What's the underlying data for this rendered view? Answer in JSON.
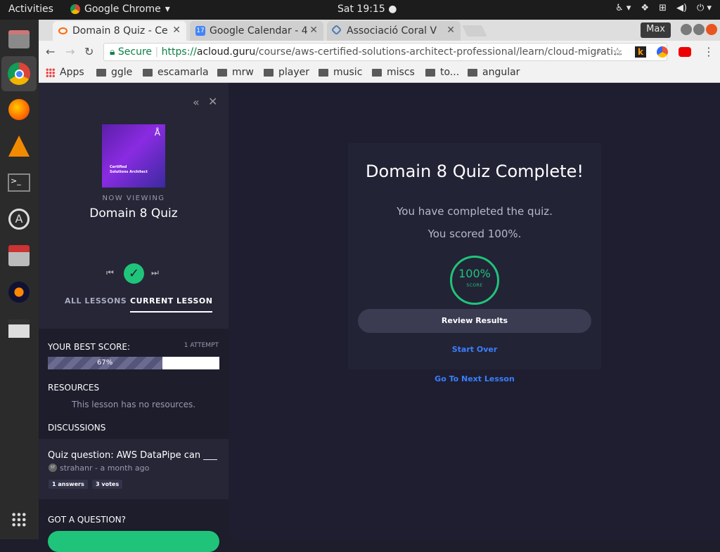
{
  "topbar": {
    "activities": "Activities",
    "app_name": "Google Chrome",
    "clock": "Sat 19:15"
  },
  "browser": {
    "tabs": [
      {
        "title": "Domain 8 Quiz - Ce",
        "active": true
      },
      {
        "title": "Google Calendar - 4",
        "active": false
      },
      {
        "title": "Associació Coral V",
        "active": false
      }
    ],
    "max_label": "Max",
    "secure_label": "Secure",
    "url_scheme": "https://",
    "url_host": "acloud.guru",
    "url_path": "/course/aws-certified-solutions-architect-professional/learn/cloud-migrati...",
    "bookmarks": [
      "Apps",
      "ggle",
      "escamarla",
      "mrw",
      "player",
      "music",
      "miscs",
      "to...",
      "angular"
    ]
  },
  "sidebar": {
    "now_viewing": "NOW VIEWING",
    "lesson_title": "Domain 8 Quiz",
    "thumb_text_1": "Certified",
    "thumb_text_2": "Solutions Architect",
    "tabs": [
      "ALL LESSONS",
      "CURRENT LESSON"
    ],
    "best_score_label": "YOUR BEST SCORE:",
    "attempts": "1 ATTEMPT",
    "best_score_value": "67%",
    "best_score_fraction": 0.67,
    "resources_label": "RESOURCES",
    "no_resources": "This lesson has no resources.",
    "discussions_label": "DISCUSSIONS",
    "discussion": {
      "title": "Quiz question: AWS DataPipe can ___",
      "avatar": "ST",
      "meta": "strahanr - a month ago",
      "answers": "1 answers",
      "votes": "3 votes"
    },
    "got_question": "GOT A QUESTION?"
  },
  "main": {
    "heading": "Domain 8 Quiz Complete!",
    "completed_text": "You have completed the quiz.",
    "scored_text": "You scored 100%.",
    "score_value": "100%",
    "score_caption": "SCORE",
    "review_button": "Review Results",
    "start_over": "Start Over",
    "next_lesson": "Go To Next Lesson"
  },
  "colors": {
    "accent_green": "#1fc47a",
    "link_blue": "#3a7fff",
    "page_bg": "#1e1e30",
    "sidebar_bg": "#262637"
  }
}
